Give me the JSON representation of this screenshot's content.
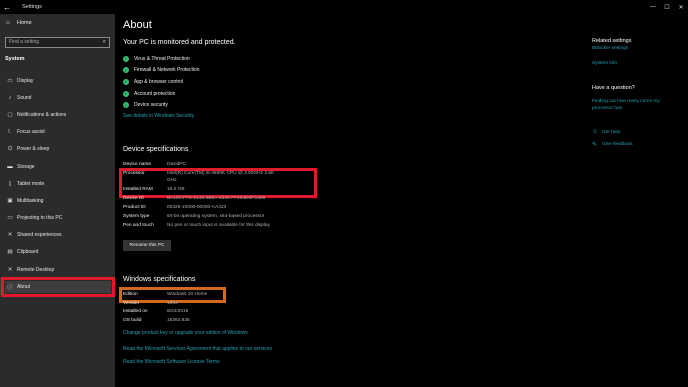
{
  "window": {
    "title": "Settings",
    "back_icon": "back-arrow-icon",
    "minimize": "—",
    "maximize": "☐",
    "close": "✕"
  },
  "sidebar": {
    "home_label": "Home",
    "search_placeholder": "Find a setting",
    "section_label": "System",
    "items": [
      {
        "label": "Display",
        "icon": "display-icon"
      },
      {
        "label": "Sound",
        "icon": "sound-icon"
      },
      {
        "label": "Notifications & actions",
        "icon": "notifications-icon"
      },
      {
        "label": "Focus assist",
        "icon": "focus-assist-icon"
      },
      {
        "label": "Power & sleep",
        "icon": "power-icon"
      },
      {
        "label": "Storage",
        "icon": "storage-icon"
      },
      {
        "label": "Tablet mode",
        "icon": "tablet-icon"
      },
      {
        "label": "Multitasking",
        "icon": "multitasking-icon"
      },
      {
        "label": "Projecting to this PC",
        "icon": "projecting-icon"
      },
      {
        "label": "Shared experiences",
        "icon": "shared-experiences-icon"
      },
      {
        "label": "Clipboard",
        "icon": "clipboard-icon"
      },
      {
        "label": "Remote Desktop",
        "icon": "remote-desktop-icon"
      },
      {
        "label": "About",
        "icon": "info-icon"
      }
    ]
  },
  "main": {
    "title": "About",
    "subtitle": "Your PC is monitored and protected.",
    "security_items": [
      "Virus & Threat Protection",
      "Firewall & Network Protection",
      "App & browser control",
      "Account protection",
      "Device security"
    ],
    "security_link": "See details in Windows Security",
    "device_heading": "Device specifications",
    "device_specs": [
      {
        "k": "Device name",
        "v": "DavidPC"
      },
      {
        "k": "Processor",
        "v": "Intel(R) Core(TM) i5-4690K CPU @ 3.50GHz   3.50"
      },
      {
        "k": "",
        "v": "GHz"
      },
      {
        "k": "Installed RAM",
        "v": "16.0 GB"
      },
      {
        "k": "Device ID",
        "v": "BA1DAF7D-6149-4B5A-8325-FF264E6FC596"
      },
      {
        "k": "Product ID",
        "v": "00326-10000-00000-AA423"
      },
      {
        "k": "System type",
        "v": "64-bit operating system, x64-based processor"
      },
      {
        "k": "Pen and touch",
        "v": "No pen or touch input is available for this display"
      }
    ],
    "rename_button": "Rename this PC",
    "windows_heading": "Windows specifications",
    "windows_specs": [
      {
        "k": "Edition",
        "v": "Windows 10 Home"
      },
      {
        "k": "Version",
        "v": "1903"
      },
      {
        "k": "Installed on",
        "v": "8/24/2019"
      },
      {
        "k": "OS build",
        "v": "18363.836"
      }
    ],
    "links": [
      "Change product key or upgrade your edition of Windows",
      "Read the Microsoft Services Agreement that applies to our services",
      "Read the Microsoft Software License Terms"
    ]
  },
  "right": {
    "related_title": "Related settings",
    "related_links": [
      "Bitlocker settings",
      "System info"
    ],
    "question_title": "Have a question?",
    "question_link_1": "Finding out how many cores my",
    "question_link_2": "processor has",
    "get_help": "Get help",
    "give_feedback": "Give feedback"
  },
  "colors": {
    "accent_link": "#28a0b4",
    "highlight_red": "#e01a2a",
    "highlight_orange": "#d2691e",
    "sidebar_bg": "#2b2b2b",
    "check_green": "#2fbf71"
  }
}
